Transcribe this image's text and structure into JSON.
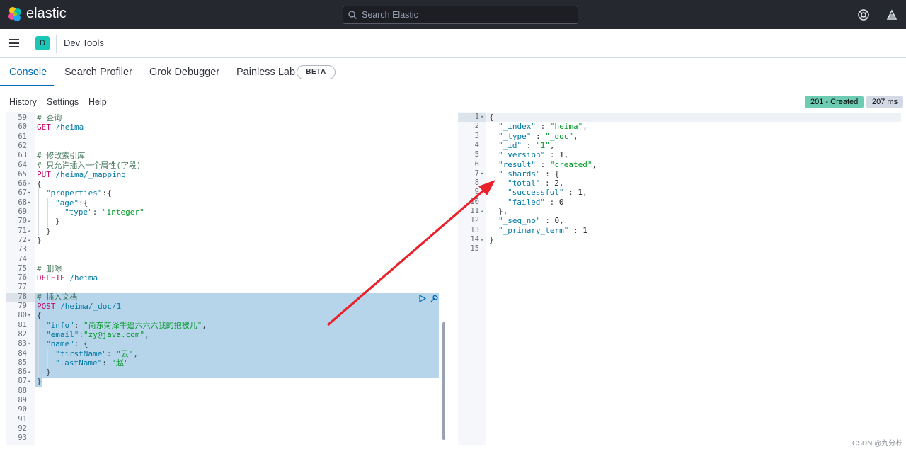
{
  "header": {
    "brand": "elastic",
    "search_placeholder": "Search Elastic",
    "icons": [
      "help-icon",
      "newsfeed-icon"
    ]
  },
  "appbar": {
    "space_initial": "D",
    "title": "Dev Tools"
  },
  "tabs": [
    {
      "label": "Console",
      "active": true
    },
    {
      "label": "Search Profiler",
      "active": false
    },
    {
      "label": "Grok Debugger",
      "active": false
    },
    {
      "label": "Painless Lab",
      "active": false,
      "badge": "BETA"
    }
  ],
  "menu": [
    "History",
    "Settings",
    "Help"
  ],
  "response_status": {
    "status": "201 - Created",
    "time": "207 ms"
  },
  "colors": {
    "accent": "#006bb4",
    "success": "#6dccb1",
    "selection": "#b6d5ea"
  },
  "request_editor": {
    "lines": [
      {
        "n": "59",
        "fold": "",
        "text": "# 查询",
        "kind": "comment",
        "indent": 0
      },
      {
        "n": "60",
        "fold": "",
        "text": "GET /heima",
        "kind": "request",
        "indent": 0
      },
      {
        "n": "61",
        "fold": "",
        "text": "",
        "kind": "plain",
        "indent": 0
      },
      {
        "n": "62",
        "fold": "",
        "text": "",
        "kind": "plain",
        "indent": 0
      },
      {
        "n": "63",
        "fold": "",
        "text": "# 修改索引库",
        "kind": "comment",
        "indent": 0
      },
      {
        "n": "64",
        "fold": "",
        "text": "# 只允许插入一个属性(字段)",
        "kind": "comment",
        "indent": 0
      },
      {
        "n": "65",
        "fold": "",
        "text": "PUT /heima/_mapping",
        "kind": "request",
        "indent": 0
      },
      {
        "n": "66",
        "fold": "▾",
        "text": "{",
        "kind": "plain",
        "indent": 0
      },
      {
        "n": "67",
        "fold": "▾",
        "text": "\"properties\":{",
        "kind": "json",
        "indent": 1
      },
      {
        "n": "68",
        "fold": "▾",
        "text": "\"age\":{",
        "kind": "json",
        "indent": 2
      },
      {
        "n": "69",
        "fold": "",
        "text": "\"type\": \"integer\"",
        "kind": "json",
        "indent": 3
      },
      {
        "n": "70",
        "fold": "▴",
        "text": "}",
        "kind": "plain",
        "indent": 2
      },
      {
        "n": "71",
        "fold": "▴",
        "text": "}",
        "kind": "plain",
        "indent": 1
      },
      {
        "n": "72",
        "fold": "▴",
        "text": "}",
        "kind": "plain",
        "indent": 0
      },
      {
        "n": "73",
        "fold": "",
        "text": "",
        "kind": "plain",
        "indent": 0
      },
      {
        "n": "74",
        "fold": "",
        "text": "",
        "kind": "plain",
        "indent": 0
      },
      {
        "n": "75",
        "fold": "",
        "text": "# 删除",
        "kind": "comment",
        "indent": 0
      },
      {
        "n": "76",
        "fold": "",
        "text": "DELETE /heima",
        "kind": "request",
        "indent": 0
      },
      {
        "n": "77",
        "fold": "",
        "text": "",
        "kind": "plain",
        "indent": 0
      },
      {
        "n": "78",
        "fold": "",
        "text": "# 插入文档",
        "kind": "comment",
        "indent": 0
      },
      {
        "n": "79",
        "fold": "",
        "text": "POST /heima/_doc/1",
        "kind": "request",
        "indent": 0
      },
      {
        "n": "80",
        "fold": "▾",
        "text": "{",
        "kind": "plain",
        "indent": 0
      },
      {
        "n": "81",
        "fold": "",
        "text": "\"info\": \"尚东菏泽牛逼六六六我的抱被儿\",",
        "kind": "json",
        "indent": 1
      },
      {
        "n": "82",
        "fold": "",
        "text": "\"email\":\"zy@java.com\",",
        "kind": "json",
        "indent": 1
      },
      {
        "n": "83",
        "fold": "▾",
        "text": "\"name\": {",
        "kind": "json",
        "indent": 1
      },
      {
        "n": "84",
        "fold": "",
        "text": "\"firstName\": \"云\",",
        "kind": "json",
        "indent": 2
      },
      {
        "n": "85",
        "fold": "",
        "text": "\"lastName\": \"赵\"",
        "kind": "json",
        "indent": 2
      },
      {
        "n": "86",
        "fold": "▴",
        "text": "}",
        "kind": "plain",
        "indent": 1
      },
      {
        "n": "87",
        "fold": "▴",
        "text": "}",
        "kind": "plain",
        "indent": 0
      },
      {
        "n": "88",
        "fold": "",
        "text": "",
        "kind": "plain",
        "indent": 0
      },
      {
        "n": "89",
        "fold": "",
        "text": "",
        "kind": "plain",
        "indent": 0
      },
      {
        "n": "90",
        "fold": "",
        "text": "",
        "kind": "plain",
        "indent": 0
      },
      {
        "n": "91",
        "fold": "",
        "text": "",
        "kind": "plain",
        "indent": 0
      },
      {
        "n": "92",
        "fold": "",
        "text": "",
        "kind": "plain",
        "indent": 0
      },
      {
        "n": "93",
        "fold": "",
        "text": "",
        "kind": "plain",
        "indent": 0
      }
    ]
  },
  "response_editor": {
    "lines": [
      {
        "n": "1",
        "fold": "▾",
        "text": "{",
        "kind": "plain",
        "indent": 0
      },
      {
        "n": "2",
        "fold": "",
        "text": "\"_index\" : \"heima\",",
        "kind": "json",
        "indent": 1
      },
      {
        "n": "3",
        "fold": "",
        "text": "\"_type\" : \"_doc\",",
        "kind": "json",
        "indent": 1
      },
      {
        "n": "4",
        "fold": "",
        "text": "\"_id\" : \"1\",",
        "kind": "json",
        "indent": 1
      },
      {
        "n": "5",
        "fold": "",
        "text": "\"_version\" : 1,",
        "kind": "json",
        "indent": 1
      },
      {
        "n": "6",
        "fold": "",
        "text": "\"result\" : \"created\",",
        "kind": "json",
        "indent": 1
      },
      {
        "n": "7",
        "fold": "▾",
        "text": "\"_shards\" : {",
        "kind": "json",
        "indent": 1
      },
      {
        "n": "8",
        "fold": "",
        "text": "\"total\" : 2,",
        "kind": "json",
        "indent": 2
      },
      {
        "n": "9",
        "fold": "",
        "text": "\"successful\" : 1,",
        "kind": "json",
        "indent": 2
      },
      {
        "n": "10",
        "fold": "",
        "text": "\"failed\" : 0",
        "kind": "json",
        "indent": 2
      },
      {
        "n": "11",
        "fold": "▴",
        "text": "},",
        "kind": "plain",
        "indent": 1
      },
      {
        "n": "12",
        "fold": "",
        "text": "\"_seq_no\" : 0,",
        "kind": "json",
        "indent": 1
      },
      {
        "n": "13",
        "fold": "",
        "text": "\"_primary_term\" : 1",
        "kind": "json",
        "indent": 1
      },
      {
        "n": "14",
        "fold": "▴",
        "text": "}",
        "kind": "plain",
        "indent": 0
      },
      {
        "n": "15",
        "fold": "",
        "text": "",
        "kind": "plain",
        "indent": 0
      }
    ]
  },
  "watermark": "CSDN @九分柠"
}
